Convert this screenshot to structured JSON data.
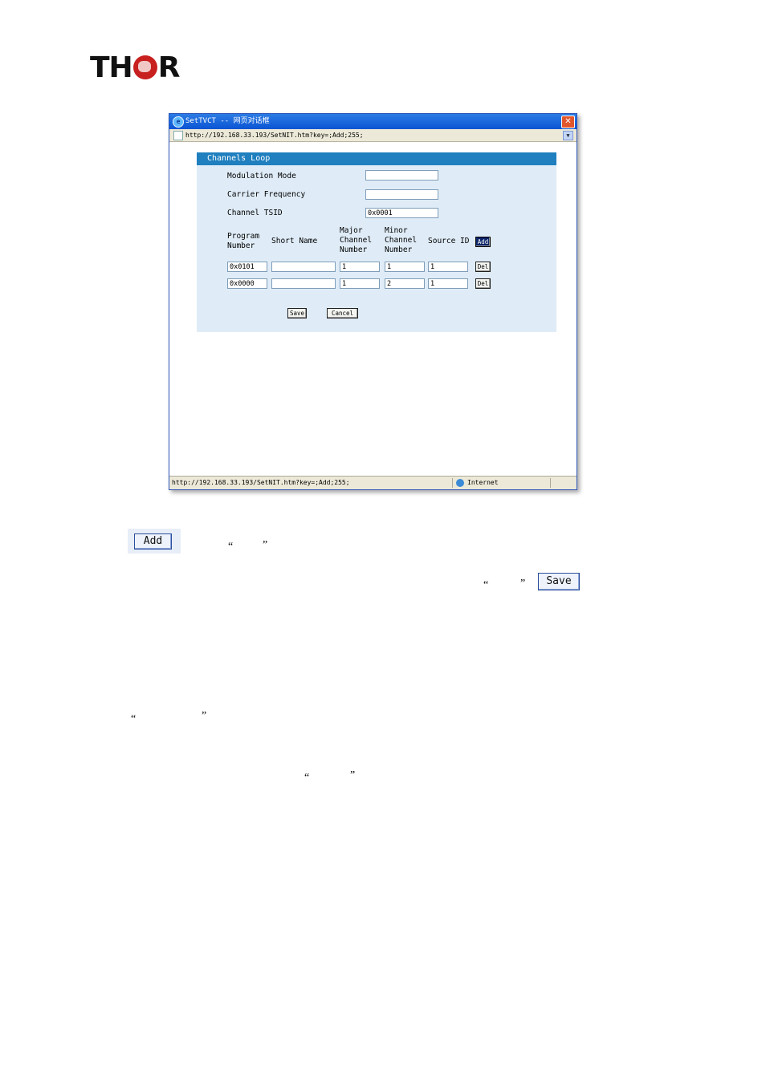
{
  "logo": {
    "left_text": "TH",
    "right_text": "R"
  },
  "dialog": {
    "title": "SetTVCT -- 网页对话框",
    "close_glyph": "✕",
    "address": "http://192.168.33.193/SetNIT.htm?key=;Add;255;",
    "panel_title": "Channels Loop",
    "fields": {
      "modulation_mode": {
        "label": "Modulation Mode",
        "value": ""
      },
      "carrier_frequency": {
        "label": "Carrier Frequency",
        "value": ""
      },
      "channel_tsid": {
        "label": "Channel TSID",
        "value": "0x0001"
      }
    },
    "table": {
      "headers": {
        "program_number": "Program Number",
        "short_name": "Short Name",
        "major_channel": "Major Channel Number",
        "minor_channel": "Minor Channel Number",
        "source_id": "Source ID"
      },
      "add_label": "Add",
      "del_label": "Del",
      "rows": [
        {
          "program_number": "0x0101",
          "short_name": "",
          "major": "1",
          "minor": "1",
          "source_id": "1"
        },
        {
          "program_number": "0x0000",
          "short_name": "",
          "major": "1",
          "minor": "2",
          "source_id": "1"
        }
      ]
    },
    "save_label": "Save",
    "cancel_label": "Cancel",
    "status_url": "http://192.168.33.193/SetNIT.htm?key=;Add;255;",
    "status_zone": "Internet"
  },
  "doc": {
    "add_button_label": "Add",
    "save_button_label": "Save",
    "open_quote": "“",
    "close_quote": "”"
  },
  "colors": {
    "panel_header": "#1f7fbf",
    "panel_bg": "#dfecf7",
    "titlebar": "#0b54d4",
    "logo_globe": "#c8201f"
  }
}
